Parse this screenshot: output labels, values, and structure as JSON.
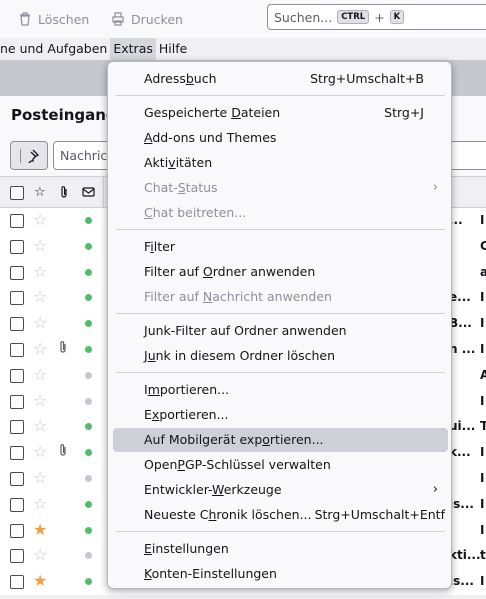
{
  "toolbar": {
    "delete_label": "Löschen",
    "print_label": "Drucken",
    "search_placeholder": "Suchen...",
    "search_key1": "CTRL",
    "search_plus": "+",
    "search_key2": "K"
  },
  "menubar": {
    "items": [
      "ne und Aufgaben",
      "Extras",
      "Hilfe"
    ]
  },
  "folder": {
    "title": "Posteingang",
    "filter_placeholder": "Nachrich"
  },
  "rows": [
    {
      "starred": false,
      "attachment": false,
      "status": "green",
      "text": "...",
      "sender_initial": "I"
    },
    {
      "starred": false,
      "attachment": false,
      "status": "green",
      "text": "",
      "sender_initial": "C"
    },
    {
      "starred": false,
      "attachment": false,
      "status": "green",
      "text": "",
      "sender_initial": "a"
    },
    {
      "starred": false,
      "attachment": false,
      "status": "green",
      "text": "e...",
      "sender_initial": "I"
    },
    {
      "starred": false,
      "attachment": false,
      "status": "green",
      "text": "B...",
      "sender_initial": "I"
    },
    {
      "starred": false,
      "attachment": true,
      "status": "green",
      "text": "n ...",
      "sender_initial": "I"
    },
    {
      "starred": false,
      "attachment": false,
      "status": "gray",
      "text": "",
      "sender_initial": "A"
    },
    {
      "starred": false,
      "attachment": false,
      "status": "gray",
      "text": "",
      "sender_initial": "I"
    },
    {
      "starred": false,
      "attachment": false,
      "status": "green",
      "text": "ui...",
      "sender_initial": "T"
    },
    {
      "starred": false,
      "attachment": true,
      "status": "green",
      "text": "k...",
      "sender_initial": "I"
    },
    {
      "starred": false,
      "attachment": false,
      "status": "gray",
      "text": "",
      "sender_initial": "I"
    },
    {
      "starred": false,
      "attachment": false,
      "status": "green",
      "text": "is...",
      "sender_initial": "I"
    },
    {
      "starred": true,
      "attachment": false,
      "status": "green",
      "text": "",
      "sender_initial": "I"
    },
    {
      "starred": false,
      "attachment": false,
      "status": "gray",
      "text": "kti...",
      "sender_initial": "t"
    },
    {
      "starred": true,
      "attachment": false,
      "status": "green",
      "text": "is...",
      "sender_initial": "I"
    }
  ],
  "menu": {
    "items": [
      {
        "label": "Adressbuch",
        "shortcut": "Strg+Umschalt+B",
        "disabled": false
      },
      {
        "label": "Gespeicherte Dateien",
        "shortcut": "Strg+J",
        "disabled": false
      },
      {
        "label": "Add-ons und Themes",
        "shortcut": "",
        "disabled": false
      },
      {
        "label": "Aktivitäten",
        "shortcut": "",
        "disabled": false
      },
      {
        "label": "Chat-Status",
        "shortcut": "",
        "disabled": true
      },
      {
        "label": "Chat beitreten...",
        "shortcut": "",
        "disabled": true
      },
      {
        "label": "Filter",
        "shortcut": "",
        "disabled": false
      },
      {
        "label": "Filter auf Ordner anwenden",
        "shortcut": "",
        "disabled": false
      },
      {
        "label": "Filter auf Nachricht anwenden",
        "shortcut": "",
        "disabled": true
      },
      {
        "label": "Junk-Filter auf Ordner anwenden",
        "shortcut": "",
        "disabled": false
      },
      {
        "label": "Junk in diesem Ordner löschen",
        "shortcut": "",
        "disabled": false
      },
      {
        "label": "Importieren...",
        "shortcut": "",
        "disabled": false
      },
      {
        "label": "Exportieren...",
        "shortcut": "",
        "disabled": false
      },
      {
        "label": "Auf Mobilgerät exportieren...",
        "shortcut": "",
        "disabled": false
      },
      {
        "label": "OpenPGP-Schlüssel verwalten",
        "shortcut": "",
        "disabled": false
      },
      {
        "label": "Entwickler-Werkzeuge",
        "shortcut": "",
        "disabled": false
      },
      {
        "label": "Neueste Chronik löschen...",
        "shortcut": "Strg+Umschalt+Entf",
        "disabled": false
      },
      {
        "label": "Einstellungen",
        "shortcut": "",
        "disabled": false
      },
      {
        "label": "Konten-Einstellungen",
        "shortcut": "",
        "disabled": false
      }
    ]
  }
}
